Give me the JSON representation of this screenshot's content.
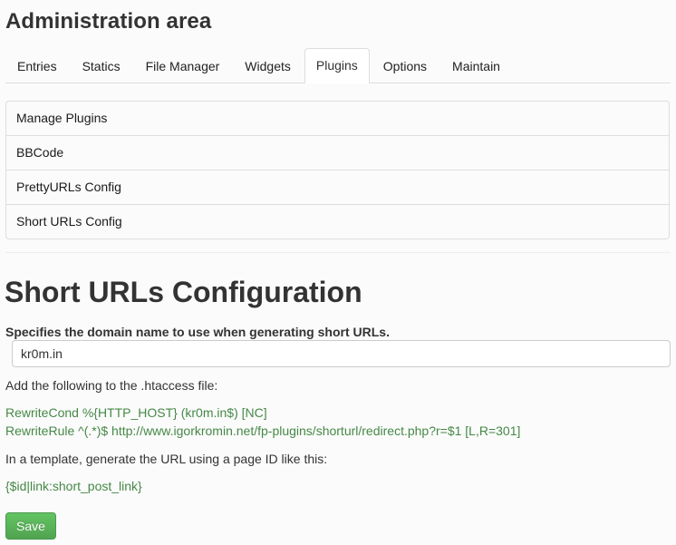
{
  "header": {
    "title": "Administration area"
  },
  "tabs": [
    {
      "label": "Entries",
      "active": false
    },
    {
      "label": "Statics",
      "active": false
    },
    {
      "label": "File Manager",
      "active": false
    },
    {
      "label": "Widgets",
      "active": false
    },
    {
      "label": "Plugins",
      "active": true
    },
    {
      "label": "Options",
      "active": false
    },
    {
      "label": "Maintain",
      "active": false
    }
  ],
  "submenu": [
    {
      "label": "Manage Plugins"
    },
    {
      "label": "BBCode"
    },
    {
      "label": "PrettyURLs Config"
    },
    {
      "label": "Short URLs Config"
    }
  ],
  "main": {
    "title": "Short URLs Configuration",
    "domain_label": "Specifies the domain name to use when generating short URLs.",
    "domain_value": "kr0m.in",
    "htaccess_intro": "Add the following to the .htaccess file:",
    "rewrite_cond": "RewriteCond %{HTTP_HOST} (kr0m.in$) [NC]",
    "rewrite_rule": "RewriteRule ^(.*)$ http://www.igorkromin.net/fp-plugins/shorturl/redirect.php?r=$1 [L,R=301]",
    "template_intro": "In a template, generate the URL using a page ID like this:",
    "template_code": "{$id|link:short_post_link}",
    "save_label": "Save"
  },
  "colors": {
    "code_green": "#468847",
    "save_button": "#5bb75b",
    "border": "#dddddd"
  }
}
